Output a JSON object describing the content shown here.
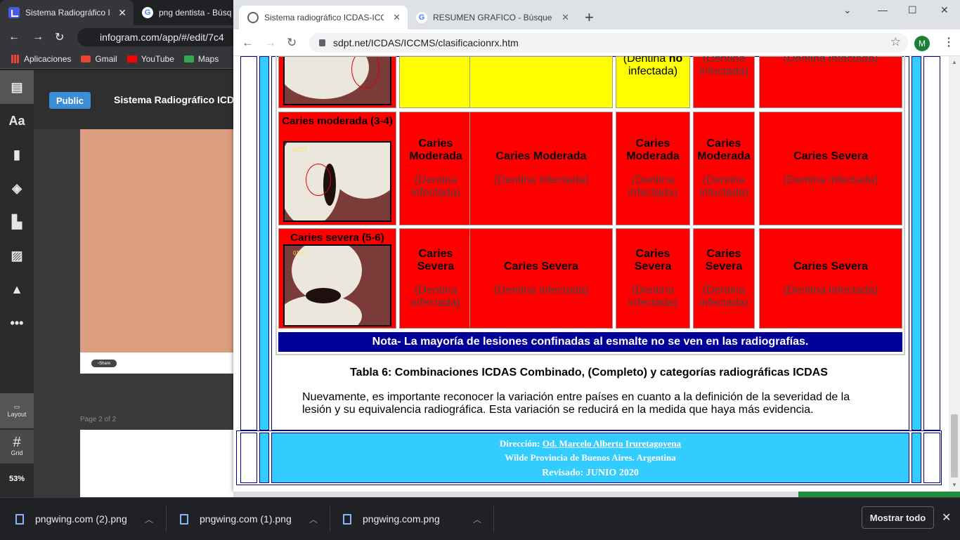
{
  "bg_window": {
    "tab1_title": "Sistema Radiográfico I",
    "tab2_title": "png dentista - Búsq",
    "url": "infogram.com/app/#/edit/7c4",
    "bookmarks": [
      "Aplicaciones",
      "Gmail",
      "YouTube",
      "Maps"
    ]
  },
  "infogram": {
    "public_label": "Public",
    "title": "Sistema Radiográfico ICD",
    "share_label": "Share",
    "page_label": "Page 2 of 2",
    "layout_label": "Layout",
    "grid_label": "Grid",
    "zoom": "53%",
    "side_icons": [
      "inbox-icon",
      "text-icon",
      "chart-icon",
      "map-icon",
      "layout-icon",
      "image-icon",
      "shapes-icon",
      "more-icon"
    ]
  },
  "window": {
    "tabs": [
      {
        "label": "Sistema radiográfico ICDAS-ICCMS"
      },
      {
        "label": "RESUMEN GRAFICO - Búsqueda de Google"
      }
    ],
    "url": "sdpt.net/ICDAS/ICCMS/clasificacionrx.htm",
    "profile_initial": "M"
  },
  "table": {
    "top_row": {
      "c3_line1": "(Dentina",
      "c3_bold": "no",
      "c3_line2": "infectada)",
      "c4": "(Dentina infectada)",
      "c5": "(Dentina infectada)"
    },
    "rows": [
      {
        "label": "Caries moderada (3-4)",
        "stamp": "07:10",
        "cells": [
          {
            "title": "Caries Moderada",
            "sub": "(Dentina infectada)"
          },
          {
            "title": "Caries Moderada",
            "sub": "(Dentina infectada)"
          },
          {
            "title": "Caries Moderada",
            "sub": "(Dentina infectada)"
          },
          {
            "title": "Caries Moderada",
            "sub": "(Dentina infectada)"
          },
          {
            "title": "Caries Severa",
            "sub": "(Dentina infectada)"
          }
        ]
      },
      {
        "label": "Caries severa (5-6)",
        "stamp": "01:47",
        "cells": [
          {
            "title": "Caries Severa",
            "sub": "(Dentina infectada)"
          },
          {
            "title": "Caries Severa",
            "sub": "(Dentina infectada)"
          },
          {
            "title": "Caries Severa",
            "sub": "(Dentina infectada)"
          },
          {
            "title": "Caries Severa",
            "sub": "(Dentina infectada)"
          },
          {
            "title": "Caries Severa",
            "sub": "(Dentina infectada)"
          }
        ]
      }
    ],
    "note": "Nota- La mayoría de lesiones confinadas al esmalte no se ven en las radiografías."
  },
  "caption": "Tabla 6: Combinaciones ICDAS Combinado, (Completo) y categorías  radiográficas ICDAS",
  "paragraph": "Nuevamente, es importante reconocer la variación entre países en cuanto a la definición de la severidad de la lesión y su equivalencia radiográfica. Esta variación se reducirá en la medida que haya más evidencia.",
  "footer": {
    "direccion_label": "Dirección:",
    "direccion_name": "Od. Marcelo Alberto Iruretagoyena",
    "location": "Wilde Provincia de Buenos Aires. Argentina",
    "revisado": "Revisado: JUNIO 2020"
  },
  "downloads": {
    "items": [
      "pngwing.com (2).png",
      "pngwing.com (1).png",
      "pngwing.com.png"
    ],
    "show_all": "Mostrar todo"
  },
  "colors": {
    "red": "#ff0000",
    "yellow": "#ffff00",
    "navy": "#000099",
    "cyan": "#33ccff"
  }
}
